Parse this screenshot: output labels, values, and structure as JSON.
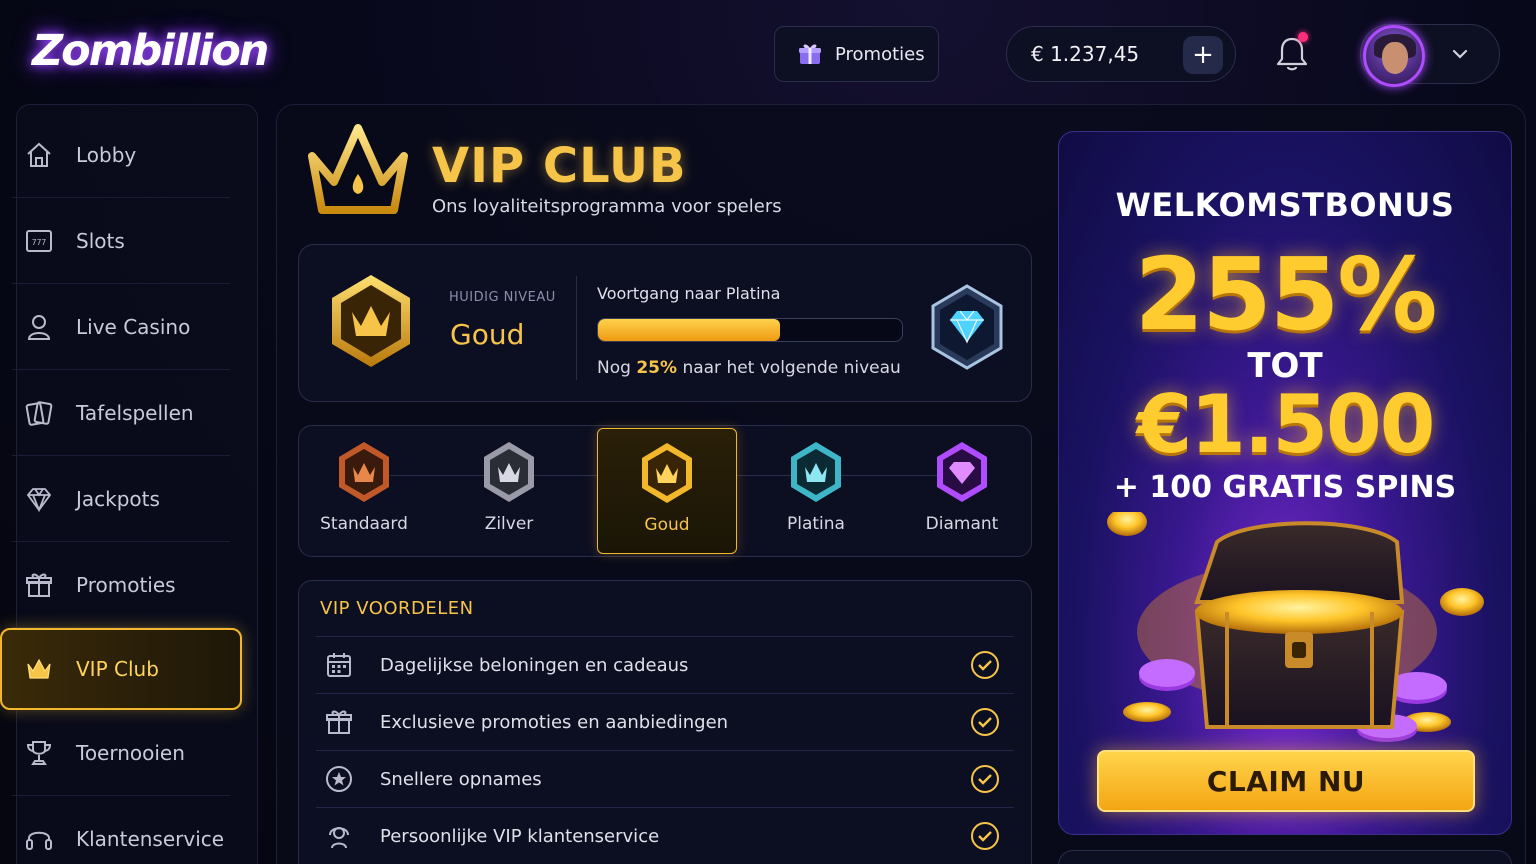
{
  "header": {
    "logo": "Zombillion",
    "promo_label": "Promoties",
    "balance": "€ 1.237,45",
    "add_funds_label": "+",
    "notification_indicator": true
  },
  "sidebar": {
    "items": [
      {
        "label": "Lobby",
        "icon": "home-icon"
      },
      {
        "label": "Slots",
        "icon": "slot-machine-icon"
      },
      {
        "label": "Live Casino",
        "icon": "dealer-icon"
      },
      {
        "label": "Tafelspellen",
        "icon": "cards-icon"
      },
      {
        "label": "Jackpots",
        "icon": "diamond-icon"
      },
      {
        "label": "Promoties",
        "icon": "gift-icon"
      },
      {
        "label": "VIP Club",
        "icon": "crown-icon",
        "active": true
      },
      {
        "label": "Toernooien",
        "icon": "trophy-icon"
      },
      {
        "label": "Klantenservice",
        "icon": "headset-icon"
      }
    ]
  },
  "vip": {
    "title": "VIP CLUB",
    "subtitle": "Ons loyaliteitsprogramma voor spelers",
    "current_level_label": "HUIDIG NIVEAU",
    "current_level": "Goud",
    "progress_label": "Voortgang naar Platina",
    "progress_fraction": 0.6,
    "progress_note_prefix": "Nog",
    "progress_note_pct": "25%",
    "progress_note_suffix": "naar het volgende niveau"
  },
  "tiers": [
    {
      "name": "Standaard",
      "color": "#c0582a"
    },
    {
      "name": "Zilver",
      "color": "#9a9aa8"
    },
    {
      "name": "Goud",
      "color": "#f2b72a",
      "active": true
    },
    {
      "name": "Platina",
      "color": "#3fb6c8"
    },
    {
      "name": "Diamant",
      "color": "#b04cff"
    }
  ],
  "benefits": {
    "title": "VIP VOORDELEN",
    "items": [
      {
        "label": "Dagelijkse beloningen en cadeaus",
        "icon": "calendar-icon"
      },
      {
        "label": "Exclusieve promoties en aanbiedingen",
        "icon": "gift-icon"
      },
      {
        "label": "Snellere opnames",
        "icon": "star-badge-icon"
      },
      {
        "label": "Persoonlijke VIP klantenservice",
        "icon": "headset-icon"
      }
    ]
  },
  "promo": {
    "heading": "WELKOMSTBONUS",
    "percent": "255%",
    "tot": "TOT",
    "amount": "€1.500",
    "spins": "+ 100 GRATIS SPINS",
    "cta": "CLAIM NU"
  },
  "colors": {
    "accent_gold": "#f7c44a",
    "bg": "#07081a",
    "panel": "#0c0e22",
    "purple": "#b04cff"
  }
}
